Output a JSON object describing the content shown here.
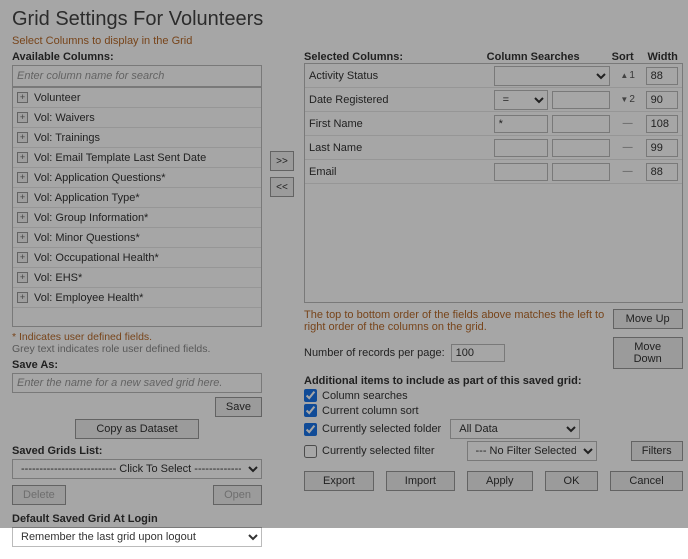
{
  "title": "Grid Settings For Volunteers",
  "subtitle": "Select Columns to display in the Grid",
  "available": {
    "label": "Available Columns:",
    "search_placeholder": "Enter column name for search",
    "items": [
      "Volunteer",
      "Vol: Waivers",
      "Vol: Trainings",
      "Vol: Email Template Last Sent Date",
      "Vol: Application Questions*",
      "Vol: Application Type*",
      "Vol: Group Information*",
      "Vol: Minor Questions*",
      "Vol: Occupational Health*",
      "Vol: EHS*",
      "Vol: Employee Health*"
    ]
  },
  "move": {
    "right": ">>",
    "left": "<<"
  },
  "selected": {
    "label": "Selected Columns:",
    "col_searches": "Column Searches",
    "sort": "Sort",
    "width": "Width",
    "rows": [
      {
        "name": "Activity Status",
        "search1_type": "select_wide",
        "search1": "",
        "search2": "",
        "sort_dir": "asc",
        "sort_n": "1",
        "width": "88"
      },
      {
        "name": "Date Registered",
        "search1_type": "select",
        "search1": "=",
        "search2": "",
        "sort_dir": "desc",
        "sort_n": "2",
        "width": "90"
      },
      {
        "name": "First Name",
        "search1_type": "text",
        "search1": "*",
        "search2": "",
        "sort_dir": "none",
        "sort_n": "",
        "width": "108"
      },
      {
        "name": "Last Name",
        "search1_type": "text",
        "search1": "",
        "search2": "",
        "sort_dir": "none",
        "sort_n": "",
        "width": "99"
      },
      {
        "name": "Email",
        "search1_type": "text",
        "search1": "",
        "search2": "",
        "sort_dir": "none",
        "sort_n": "",
        "width": "88"
      }
    ]
  },
  "notes": {
    "udf": "* Indicates user defined fields.",
    "role": "Grey text indicates role user defined fields."
  },
  "saveas": {
    "label": "Save As:",
    "placeholder": "Enter the name for a new saved grid here.",
    "save_btn": "Save",
    "copy_btn": "Copy as Dataset"
  },
  "saved_list": {
    "label": "Saved Grids List:",
    "placeholder": "-------------------------- Click To Select --------------------------",
    "delete_btn": "Delete",
    "open_btn": "Open"
  },
  "default_grid": {
    "label": "Default Saved Grid At Login",
    "value": "Remember the last grid upon logout"
  },
  "order_hint": "The top to bottom order of the fields above matches the left to right order of the columns on the grid.",
  "move_up": "Move Up",
  "move_down": "Move Down",
  "records": {
    "label": "Number of records per page:",
    "value": "100"
  },
  "additional": {
    "label": "Additional items to include as part of this saved grid:",
    "column_searches": "Column searches",
    "current_sort": "Current column sort",
    "selected_folder": "Currently selected folder",
    "folder_value": "All Data",
    "selected_filter": "Currently selected filter",
    "filter_value": "--- No Filter Selected ---",
    "filters_btn": "Filters"
  },
  "buttons": {
    "export": "Export",
    "import": "Import",
    "apply": "Apply",
    "ok": "OK",
    "cancel": "Cancel"
  }
}
